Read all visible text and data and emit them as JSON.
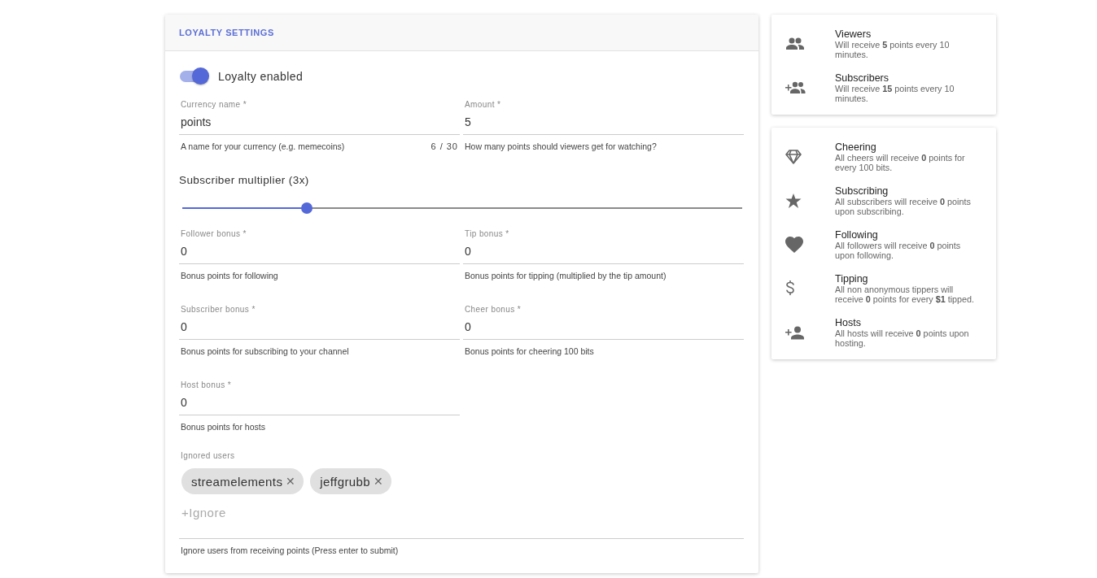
{
  "loyalty_settings": {
    "title": "LOYALTY SETTINGS",
    "toggle": {
      "label": "Loyalty enabled",
      "on": true
    },
    "currency_fields": [
      {
        "label": "Currency name *",
        "value": "points",
        "hint": "A name for your currency (e.g. memecoins)",
        "counter": "6 / 30"
      },
      {
        "label": "Amount *",
        "value": "5",
        "hint": "How many points should viewers get for watching?"
      }
    ],
    "multiplier": {
      "label": "Subscriber multiplier (3x)",
      "level": 0.222
    },
    "bonus_fields": [
      {
        "label": "Follower bonus *",
        "value": "0",
        "hint": "Bonus points for following"
      },
      {
        "label": "Tip bonus *",
        "value": "0",
        "hint": "Bonus points for tipping (multiplied by the tip amount)"
      },
      {
        "label": "Subscriber bonus *",
        "value": "0",
        "hint": "Bonus points for subscribing to your channel"
      },
      {
        "label": "Cheer bonus *",
        "value": "0",
        "hint": "Bonus points for cheering 100 bits"
      },
      {
        "label": "Host bonus *",
        "value": "0",
        "hint": "Bonus points for hosts"
      }
    ],
    "ignored_users": {
      "label": "Ignored users",
      "chips": [
        "streamelements",
        "jeffgrubb"
      ],
      "chip_remove": "✕",
      "placeholder": "+Ignore",
      "hint": "Ignore users from receiving points (Press enter to submit)"
    }
  },
  "summary_cards": [
    {
      "items": [
        {
          "kind": "group",
          "title": "Viewers",
          "text": "Will receive **5** points every 10 minutes."
        },
        {
          "kind": "group-add",
          "title": "Subscribers",
          "text": "Will receive **15** points every 10 minutes."
        }
      ]
    },
    {
      "items": [
        {
          "kind": "diamond",
          "title": "Cheering",
          "text": "All cheers will receive **0** points for every 100 bits."
        },
        {
          "kind": "star",
          "title": "Subscribing",
          "text": "All subscribers will receive **0** points upon subscribing."
        },
        {
          "kind": "heart",
          "title": "Following",
          "text": "All followers will receive **0** points upon following."
        },
        {
          "kind": "dollar",
          "title": "Tipping",
          "text": "All non anonymous tippers will receive **0** points for every **$1** tipped."
        },
        {
          "kind": "person-add",
          "title": "Hosts",
          "text": "All hosts will receive **0** points upon hosting."
        }
      ]
    }
  ]
}
